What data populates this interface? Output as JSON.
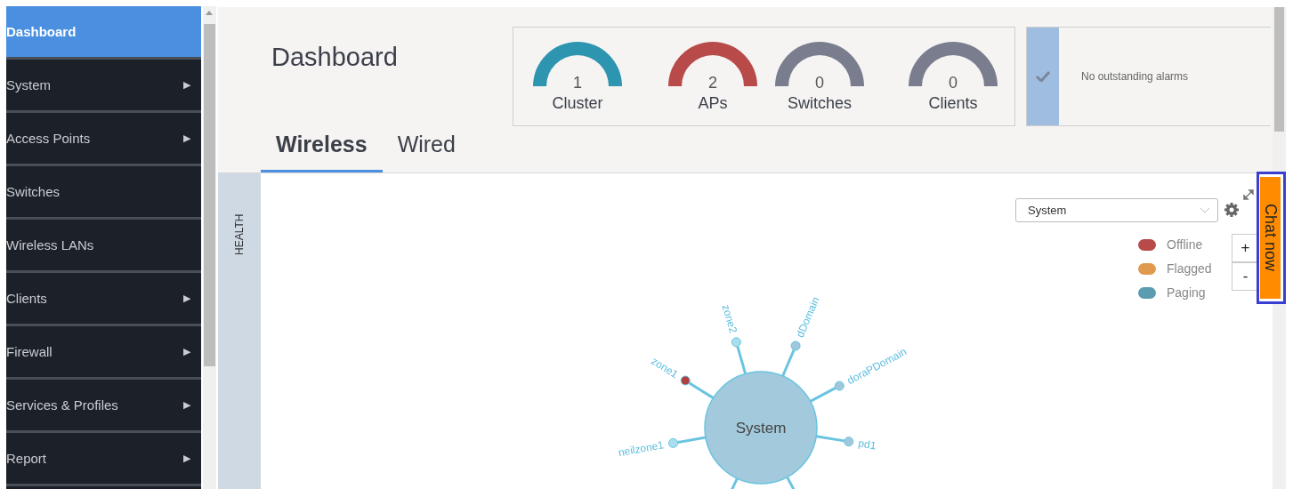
{
  "sidebar": {
    "items": [
      {
        "label": "Dashboard",
        "selected": true
      },
      {
        "label": "System",
        "selected": false,
        "arrow": "▶"
      },
      {
        "label": "Access Points",
        "selected": false,
        "arrow": "▶"
      },
      {
        "label": "Switches",
        "selected": false
      },
      {
        "label": "Wireless LANs",
        "selected": false
      },
      {
        "label": "Clients",
        "selected": false,
        "arrow": "▶"
      },
      {
        "label": "Firewall",
        "selected": false,
        "arrow": "▶"
      },
      {
        "label": "Services & Profiles",
        "selected": false,
        "arrow": "▶"
      },
      {
        "label": "Report",
        "selected": false,
        "arrow": "▶"
      }
    ]
  },
  "page_title": "Dashboard",
  "gauges": [
    {
      "value": "1",
      "label": "Cluster",
      "color": "#2e95b0"
    },
    {
      "value": "2",
      "label": "APs",
      "color": "#b94a4a"
    },
    {
      "value": "0",
      "label": "Switches",
      "color": "#7a7d8e"
    },
    {
      "value": "0",
      "label": "Clients",
      "color": "#7a7d8e"
    }
  ],
  "alarms": {
    "message": "No outstanding alarms"
  },
  "tabs": [
    {
      "label": "Wireless",
      "selected": true
    },
    {
      "label": "Wired",
      "selected": false
    }
  ],
  "side_tab": "HEALTH",
  "scope_select": {
    "value": "System"
  },
  "legend": [
    {
      "label": "Offline",
      "color": "#b94a4a"
    },
    {
      "label": "Flagged",
      "color": "#e09a4e"
    },
    {
      "label": "Paging",
      "color": "#5b9cb0"
    }
  ],
  "zoom_buttons": [
    "+",
    "-"
  ],
  "topology": {
    "center": "System",
    "nodes": [
      {
        "label": "zone1",
        "color": "#b04040"
      },
      {
        "label": "zone2",
        "color": "#a8dfee"
      },
      {
        "label": "dDomain",
        "color": "#9fc8dc"
      },
      {
        "label": "doraPDomain",
        "color": "#9fc8dc"
      },
      {
        "label": "pd1",
        "color": "#9fc8dc"
      },
      {
        "label": "neilzone1",
        "color": "#a8dfee"
      }
    ]
  },
  "chat_button": "Chat now"
}
